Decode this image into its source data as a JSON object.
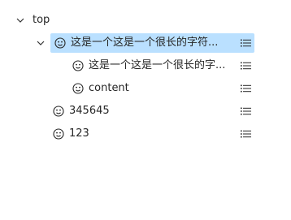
{
  "tree": {
    "root": {
      "title": "top",
      "expanded": true,
      "icon": "chevron-down-icon"
    },
    "items": [
      {
        "title": "这是一个这是一个很长的字符...",
        "icon": "smiley-icon",
        "expanded": true,
        "selected": true,
        "action_icon": "unordered-list-icon"
      },
      {
        "title": "这是一个这是一个很长的字...",
        "icon": "smiley-icon",
        "action_icon": "unordered-list-icon"
      },
      {
        "title": "content",
        "icon": "smiley-icon",
        "action_icon": "unordered-list-icon"
      },
      {
        "title": "345645",
        "icon": "smiley-icon",
        "action_icon": "unordered-list-icon"
      },
      {
        "title": "123",
        "icon": "smiley-icon",
        "action_icon": "unordered-list-icon"
      }
    ]
  },
  "colors": {
    "selected_background": "#bae0ff",
    "text": "#262626",
    "icon": "#262626"
  }
}
